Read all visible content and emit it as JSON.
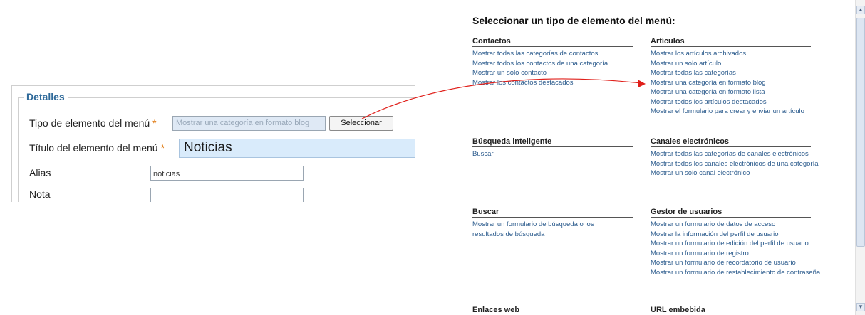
{
  "form": {
    "legend": "Detalles",
    "fields": {
      "type_label": "Tipo de elemento del menú",
      "type_value": "Mostrar una categoría en formato blog",
      "select_button": "Seleccionar",
      "title_label": "Título del elemento del menú",
      "title_value": "Noticias",
      "alias_label": "Alias",
      "alias_value": "noticias",
      "note_label": "Nota",
      "note_value": "",
      "required_marker": "*"
    }
  },
  "menu_types": {
    "heading": "Seleccionar un tipo de elemento del menú:",
    "categories": [
      {
        "title": "Contactos",
        "links": [
          "Mostrar todas las categorías de contactos",
          "Mostrar todos los contactos de una categoría",
          "Mostrar un solo contacto",
          "Mostrar los contactos destacados"
        ]
      },
      {
        "title": "Artículos",
        "links": [
          "Mostrar los artículos archivados",
          "Mostrar un solo artículo",
          "Mostrar todas las categorías",
          "Mostrar una categoría en formato blog",
          "Mostrar una categoría en formato lista",
          "Mostrar todos los artículos destacados",
          "Mostrar el formulario para crear y enviar un artículo"
        ]
      },
      {
        "title": "Búsqueda inteligente",
        "links": [
          "Buscar"
        ]
      },
      {
        "title": "Canales electrónicos",
        "links": [
          "Mostrar todas las categorías de canales electrónicos",
          "Mostrar todos los canales electrónicos de una categoría",
          "Mostrar un solo canal electrónico"
        ]
      },
      {
        "title": "Buscar",
        "links": [
          "Mostrar un formulario de búsqueda o los resultados de búsqueda"
        ]
      },
      {
        "title": "Gestor de usuarios",
        "links": [
          "Mostrar un formulario de datos de acceso",
          "Mostrar la información del perfil de usuario",
          "Mostrar un formulario de edición del perfil de usuario",
          "Mostrar un formulario de registro",
          "Mostrar un formulario de recordatorio de usuario",
          "Mostrar un formulario de restablecimiento de contraseña"
        ]
      },
      {
        "title": "Enlaces web",
        "links": []
      },
      {
        "title": "URL embebida",
        "links": []
      }
    ]
  },
  "colors": {
    "annotation_arrow": "#e0201b",
    "link": "#2a5a8c",
    "legend": "#2f6a9a"
  }
}
